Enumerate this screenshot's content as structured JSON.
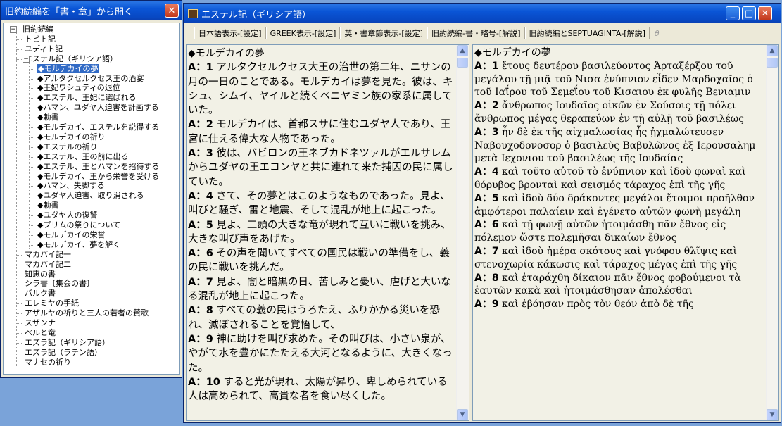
{
  "left_window": {
    "title": "旧約続編を「書・章」から開く",
    "close_glyph": "✕"
  },
  "tree": {
    "root": "旧約続編",
    "books_before": [
      "トビト記",
      "ユディト記"
    ],
    "expanded_book": "エステル記（ギリシア語）",
    "chapters": [
      "◆モルデカイの夢",
      "◆アルタクセルクセス王の酒宴",
      "◆王妃ワシュティの退位",
      "◆エステル、王妃に選ばれる",
      "◆ハマン、ユダヤ人迫害を計画する",
      "◆勅書",
      "◆モルデカイ、エステルを説得する",
      "◆モルデカイの祈り",
      "◆エステルの祈り",
      "◆エステル、王の前に出る",
      "◆エステル、王とハマンを招待する",
      "◆モルデカイ、王から栄誉を受ける",
      "◆ハマン、失脚する",
      "◆ユダヤ人迫害、取り消される",
      "◆勅書",
      "◆ユダヤ人の復讐",
      "◆プリムの祭りについて",
      "◆モルデカイの栄誉",
      "◆モルデカイ、夢を解く"
    ],
    "books_after": [
      "マカバイ記一",
      "マカバイ記二",
      "知恵の書",
      "シラ書〔集会の書〕",
      "バルク書",
      "エレミヤの手紙",
      "アザルヤの祈りと三人の若者の賛歌",
      "スザンナ",
      "ベルと竜",
      "エズラ記（ギリシア語）",
      "エズラ記（ラテン語）",
      "マナセの祈り"
    ]
  },
  "main_window": {
    "title": "エステル記（ギリシア語）",
    "min_glyph": "_",
    "max_glyph": "□",
    "close_glyph": "✕"
  },
  "toolbar": {
    "items": [
      "日本語表示-[設定]",
      "GREEK表示-[設定]",
      "英・書章節表示-[設定]",
      "旧約続編-書・略号-[解説]",
      "旧約続編とSEPTUAGINTA-[解説]"
    ],
    "theta": "θ"
  },
  "japanese": {
    "heading": "◆モルデカイの夢",
    "verses": [
      {
        "label": "A：1",
        "text": "アルタクセルクセス大王の治世の第二年、ニサンの月の一日のことである。モルデカイは夢を見た。彼は、キシュ、シムイ、ヤイルと続くベニヤミン族の家系に属していた。"
      },
      {
        "label": "A：2",
        "text": "モルデカイは、首都スサに住むユダヤ人であり、王宮に仕える偉大な人物であった。"
      },
      {
        "label": "A：3",
        "text": "彼は、バビロンの王ネブカドネツァルがエルサレムからユダヤの王エコンヤと共に連れて来た捕囚の民に属していた。"
      },
      {
        "label": "A：4",
        "text": "さて、その夢とはこのようなものであった。見よ、叫びと騒ぎ、雷と地震、そして混乱が地上に起こった。"
      },
      {
        "label": "A：5",
        "text": "見よ、二頭の大きな竜が現れて互いに戦いを挑み、大きな叫び声をあげた。"
      },
      {
        "label": "A：6",
        "text": "その声を聞いてすべての国民は戦いの準備をし、義の民に戦いを挑んだ。"
      },
      {
        "label": "A：7",
        "text": "見よ、闇と暗黒の日、苦しみと憂い、虐げと大いなる混乱が地上に起こった。"
      },
      {
        "label": "A：8",
        "text": "すべての義の民はうろたえ、ふりかかる災いを恐れ、滅ぼされることを覚悟して、"
      },
      {
        "label": "A：9",
        "text": "神に助けを叫び求めた。その叫びは、小さい泉が、やがて水を豊かにたたえる大河となるように、大きくなった。"
      },
      {
        "label": "A：10",
        "text": "すると光が現れ、太陽が昇り、卑しめられている人は高められて、高貴な者を食い尽くした。"
      }
    ]
  },
  "greek": {
    "heading": "◆モルデカイの夢",
    "verses": [
      {
        "label": "A：1",
        "text": "ἔτους δευτέρου βασιλεύοντος Ἀρταξέρξου τοῦ μεγάλου τῇ μιᾷ τοῦ Νισα ἐνύπνιον εἶδεν Μαρδοχαῖος ὁ τοῦ Ιαΐρου τοῦ Σεμεΐου τοῦ Κισαιου ἐκ φυλῆς Βενιαμιν"
      },
      {
        "label": "A：2",
        "text": "ἄνθρωπος Ιουδαῖος οἰκῶν ἐν Σούσοις τῇ πόλει ἄνθρωπος μέγας θεραπεύων ἐν τῇ αὐλῇ τοῦ βασιλέως"
      },
      {
        "label": "A：3",
        "text": "ἦν δὲ ἐκ τῆς αἰχμαλωσίας ἧς ᾐχμαλώτευσεν Ναβουχοδονοσορ ὁ βασιλεὺς Βαβυλῶνος ἐξ Ιερουσαλημ μετὰ Ιεχονιου τοῦ βασιλέως τῆς Ιουδαίας"
      },
      {
        "label": "A：4",
        "text": "καὶ τοῦτο αὐτοῦ τὸ ἐνύπνιον καὶ ἰδοὺ φωναὶ καὶ θόρυβος βρονταὶ καὶ σεισμός τάραχος ἐπὶ τῆς γῆς"
      },
      {
        "label": "A：5",
        "text": "καὶ ἰδοὺ δύο δράκοντες μεγάλοι ἕτοιμοι προῆλθον ἀμφότεροι παλαίειν καὶ ἐγένετο αὐτῶν φωνὴ μεγάλη"
      },
      {
        "label": "A：6",
        "text": "καὶ τῇ φωνῇ αὐτῶν ἡτοιμάσθη πᾶν ἔθνος εἰς πόλεμον ὥστε πολεμῆσαι δικαίων ἔθνος"
      },
      {
        "label": "A：7",
        "text": "καὶ ἰδοὺ ἡμέρα σκότους καὶ γνόφου θλῖψις καὶ στενοχωρία κάκωσις καὶ τάραχος μέγας ἐπὶ τῆς γῆς"
      },
      {
        "label": "A：8",
        "text": "καὶ ἐταράχθη δίκαιον πᾶν ἔθνος φοβούμενοι τὰ ἑαυτῶν κακὰ καὶ ἡτοιμάσθησαν ἀπολέσθαι"
      },
      {
        "label": "A：9",
        "text": "καὶ ἐβόησαν πρὸς τὸν θεόν ἀπὸ δὲ τῆς"
      }
    ]
  },
  "scroll": {
    "up": "▲",
    "down": "▼"
  }
}
